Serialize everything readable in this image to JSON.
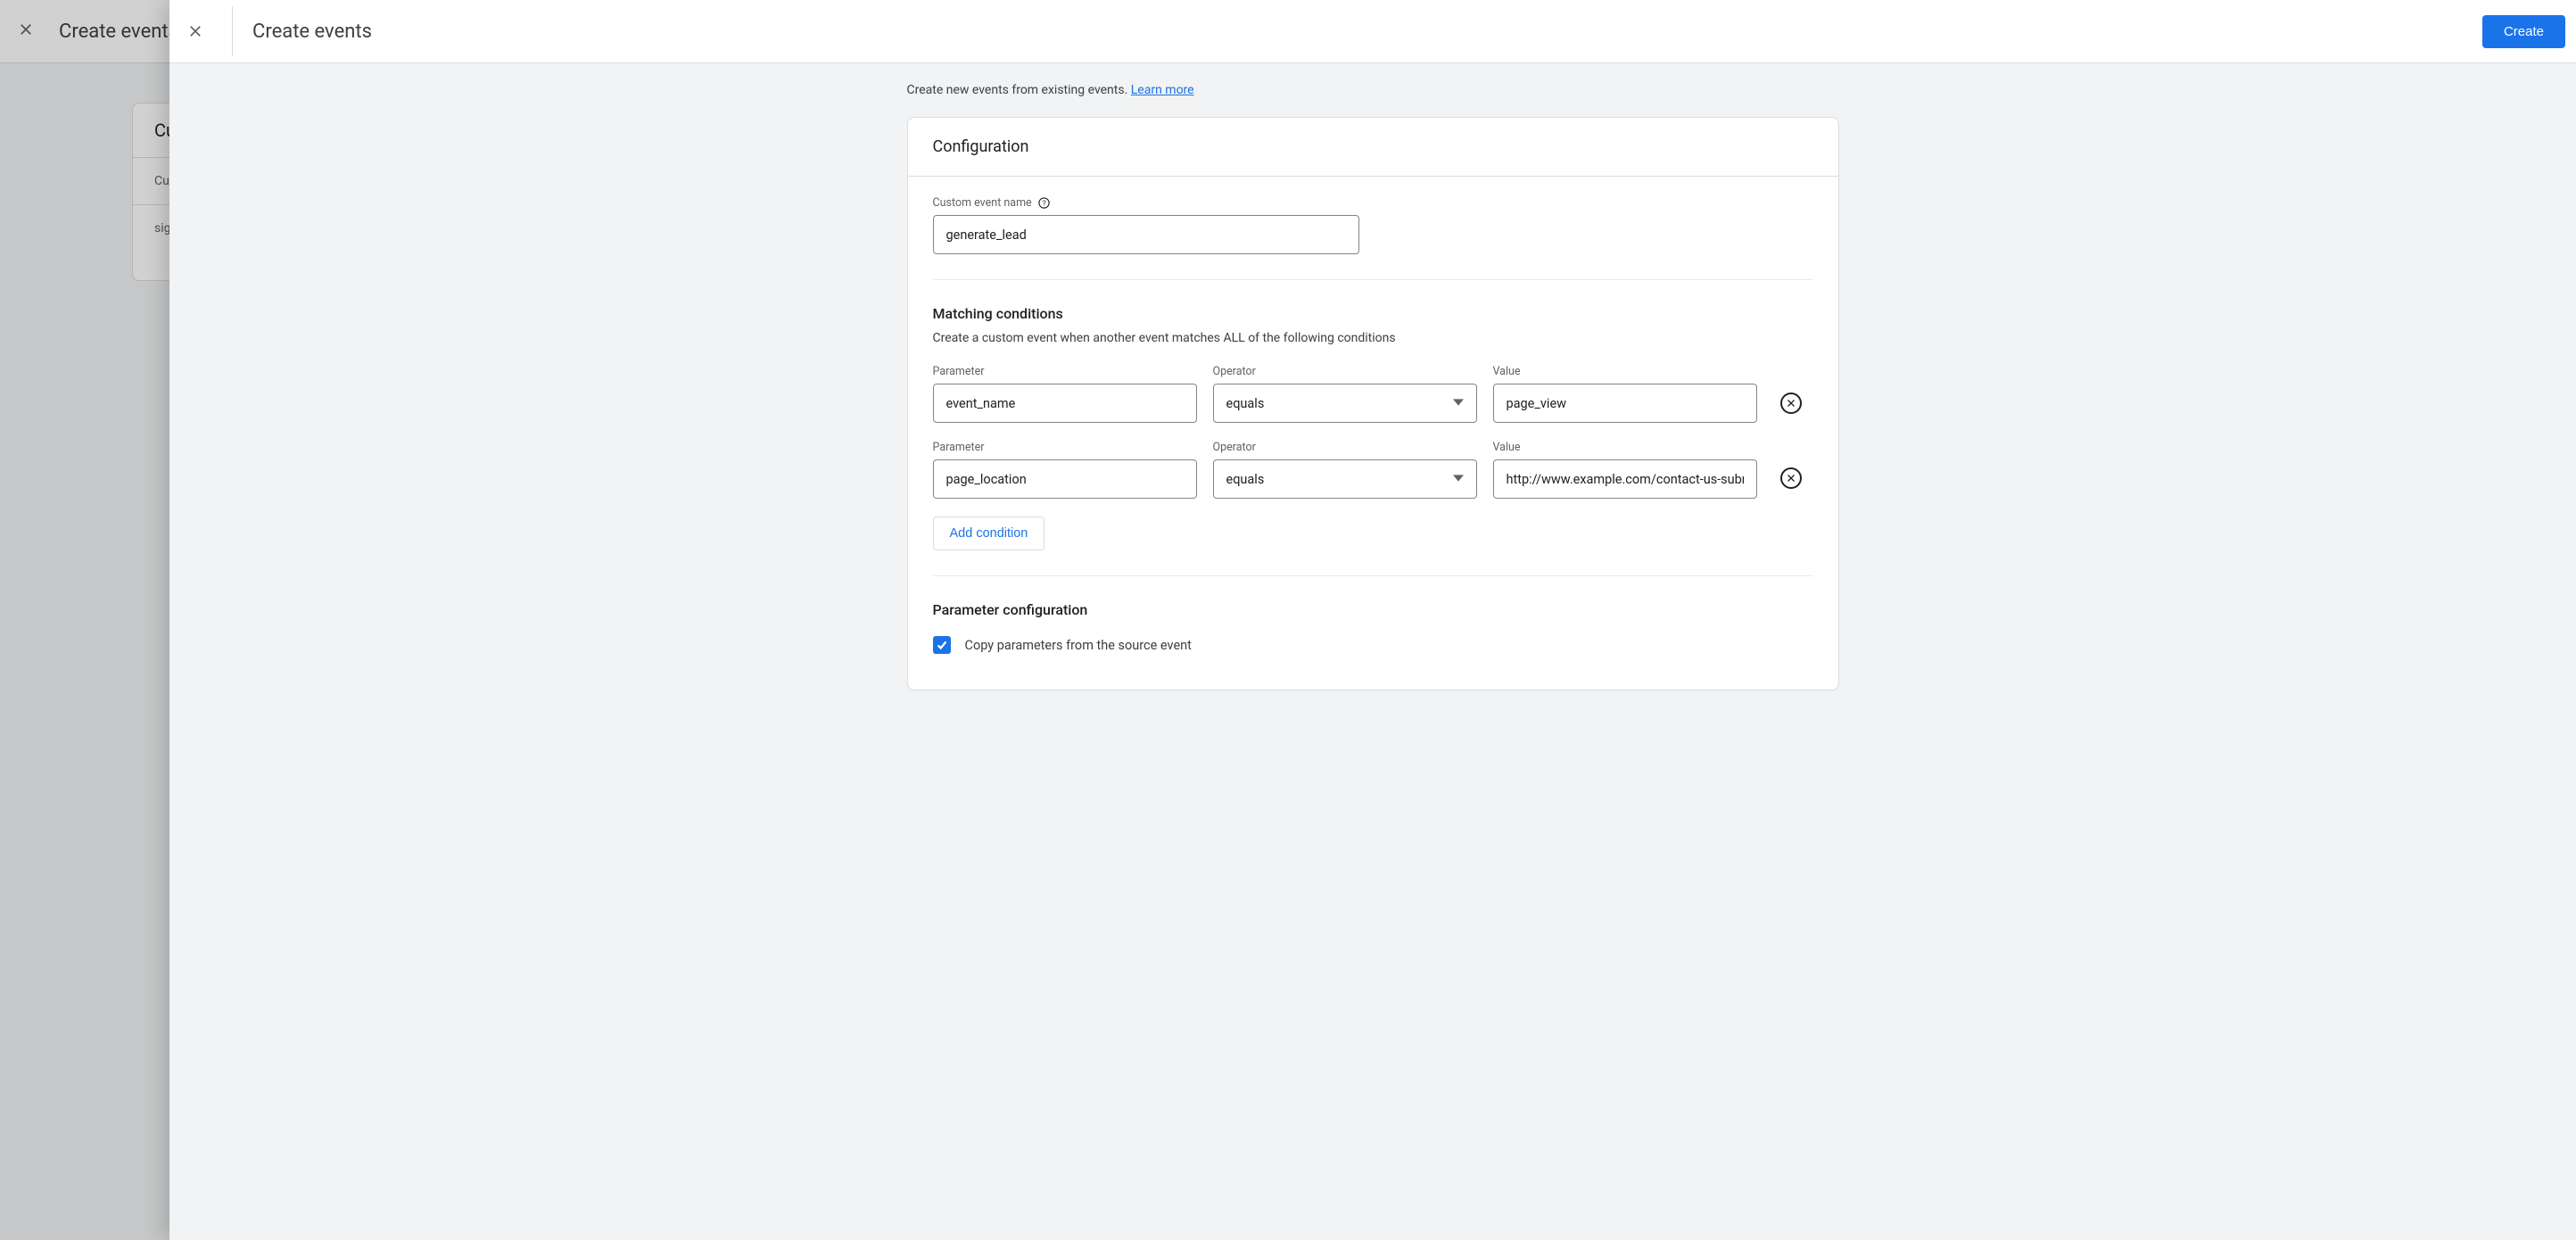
{
  "bg": {
    "title": "Create events",
    "card_head": "Cu",
    "row1": "Cus",
    "row2": "sig"
  },
  "panel": {
    "title": "Create events",
    "create_label": "Create"
  },
  "intro": {
    "text": "Create new events from existing events. ",
    "link": "Learn more"
  },
  "config": {
    "card_title": "Configuration",
    "event_name_label": "Custom event name",
    "event_name_value": "generate_lead",
    "matching_title": "Matching conditions",
    "matching_sub": "Create a custom event when another event matches ALL of the following conditions",
    "col_parameter": "Parameter",
    "col_operator": "Operator",
    "col_value": "Value",
    "conditions": [
      {
        "parameter": "event_name",
        "operator": "equals",
        "value": "page_view"
      },
      {
        "parameter": "page_location",
        "operator": "equals",
        "value": "http://www.example.com/contact-us-submit"
      }
    ],
    "add_condition_label": "Add condition",
    "param_config_title": "Parameter configuration",
    "copy_params_label": "Copy parameters from the source event",
    "copy_params_checked": true
  }
}
